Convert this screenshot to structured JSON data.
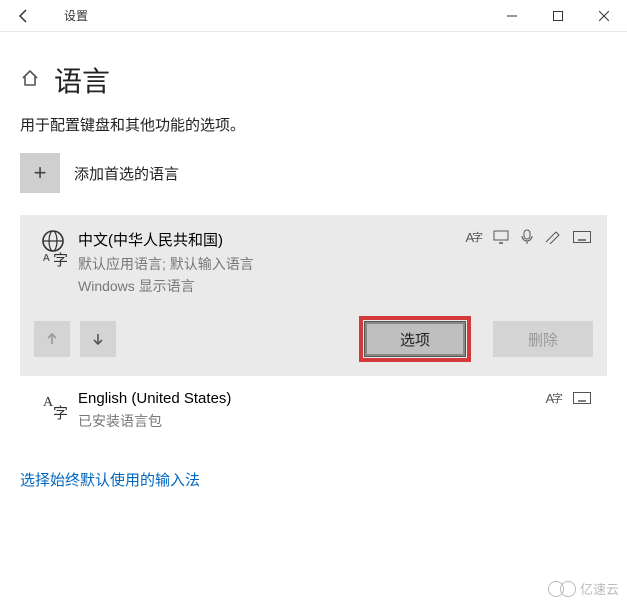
{
  "titlebar": {
    "title": "设置"
  },
  "header": {
    "page_title": "语言",
    "subtitle": "用于配置键盘和其他功能的选项。"
  },
  "add": {
    "label": "添加首选的语言"
  },
  "languages": [
    {
      "name": "中文(中华人民共和国)",
      "desc1": "默认应用语言; 默认输入语言",
      "desc2": "Windows 显示语言"
    },
    {
      "name": "English (United States)",
      "desc1": "已安装语言包",
      "desc2": ""
    }
  ],
  "actions": {
    "options": "选项",
    "delete": "删除"
  },
  "link": "选择始终默认使用的输入法",
  "watermark": "亿速云"
}
